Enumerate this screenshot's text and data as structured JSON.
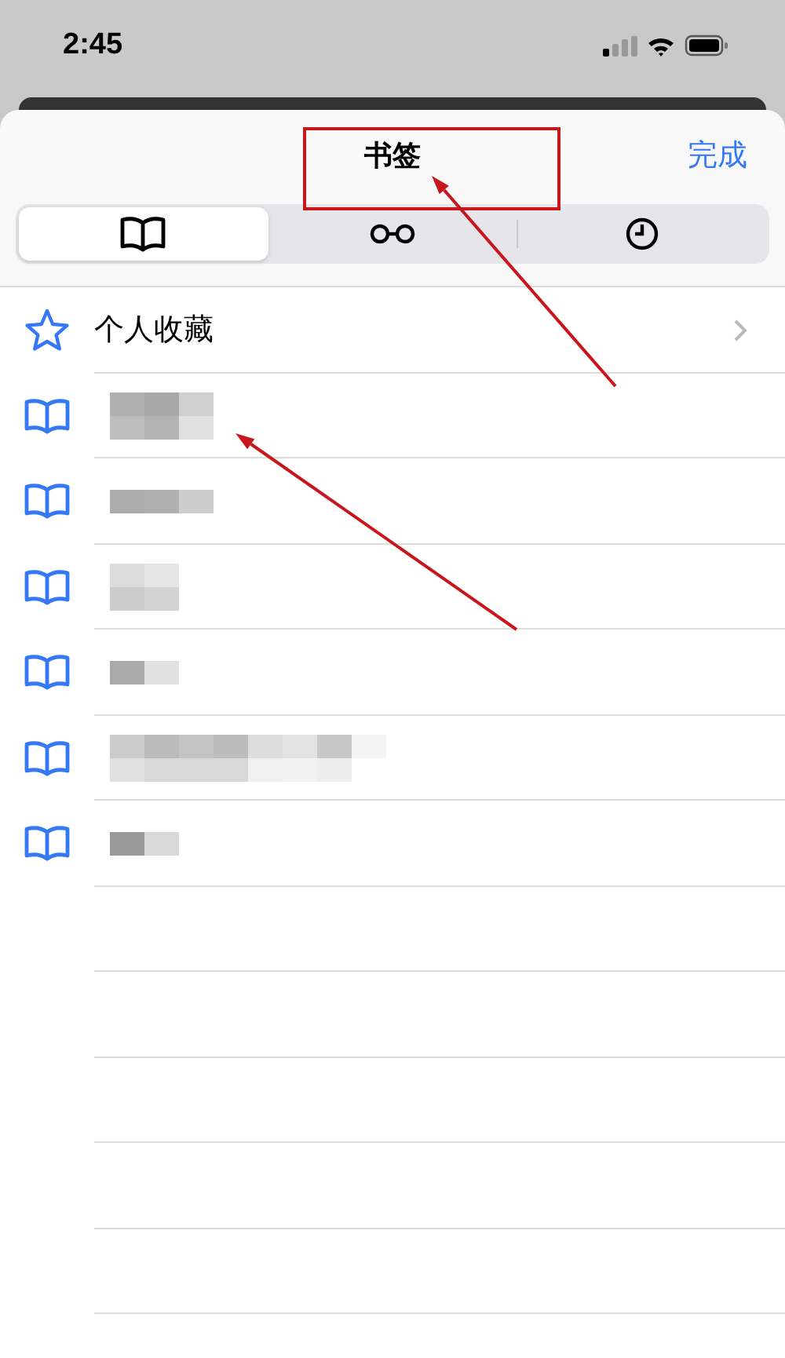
{
  "status_bar": {
    "time": "2:45"
  },
  "header": {
    "title": "书签",
    "done": "完成"
  },
  "tabs": [
    {
      "selected": true
    },
    {
      "selected": false
    },
    {
      "selected": false
    }
  ],
  "rows": [
    {
      "kind": "favorites",
      "label": "个人收藏"
    },
    {
      "kind": "bookmark",
      "redacted": true
    },
    {
      "kind": "bookmark",
      "redacted": true
    },
    {
      "kind": "bookmark",
      "redacted": true
    },
    {
      "kind": "bookmark",
      "redacted": true
    },
    {
      "kind": "bookmark",
      "redacted": true
    },
    {
      "kind": "bookmark",
      "redacted": true
    }
  ],
  "annotations": [
    {
      "kind": "box"
    },
    {
      "kind": "arrow"
    },
    {
      "kind": "arrow"
    }
  ]
}
